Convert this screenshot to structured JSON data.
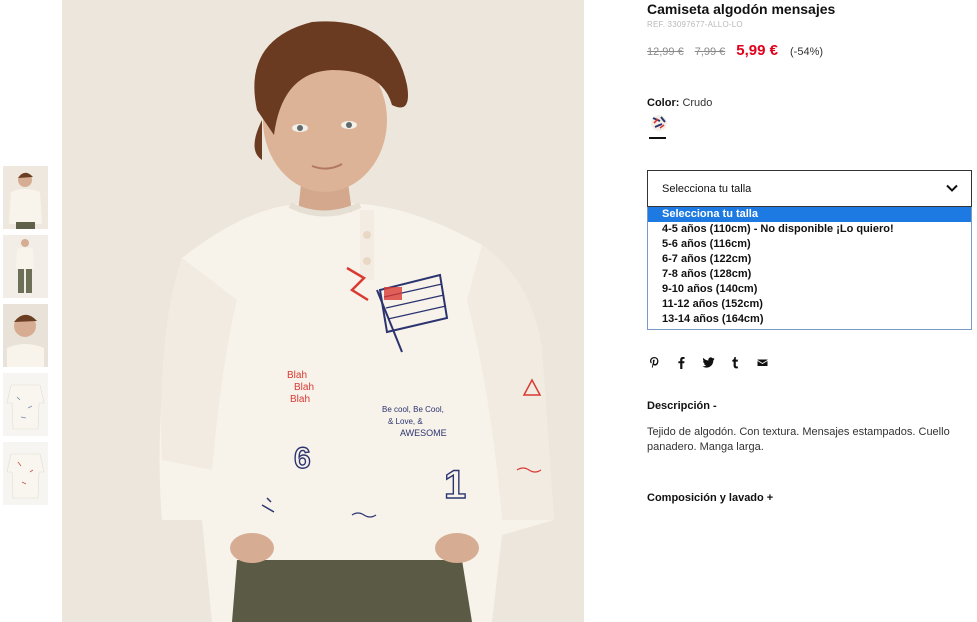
{
  "product": {
    "title": "Camiseta algodón mensajes",
    "ref": "REF. 33097677-ALLO-LO",
    "price_original": "12,99 €",
    "price_previous": "7,99 €",
    "price_sale": "5,99 €",
    "discount": "(-54%)",
    "colors": {
      "sale": "#e0001b"
    }
  },
  "color": {
    "label": "Color:",
    "value": "Crudo"
  },
  "size_select": {
    "value": "Selecciona tu talla",
    "options": [
      "Selecciona tu talla",
      "4-5 años (110cm) - No disponible ¡Lo quiero!",
      "5-6 años (116cm)",
      "6-7 años (122cm)",
      "7-8 años (128cm)",
      "9-10 años (140cm)",
      "11-12 años (152cm)",
      "13-14 años (164cm)"
    ],
    "highlighted_index": 0
  },
  "social": {
    "icons": [
      "pinterest-icon",
      "facebook-icon",
      "twitter-icon",
      "tumblr-icon",
      "email-icon"
    ]
  },
  "description": {
    "heading": "Descripción -",
    "text": "Tejido de algodón. Con textura. Mensajes estampados. Cuello panadero. Manga larga."
  },
  "composition": {
    "heading": "Composición y lavado +"
  },
  "gallery": {
    "thumbnail_count": 5
  }
}
